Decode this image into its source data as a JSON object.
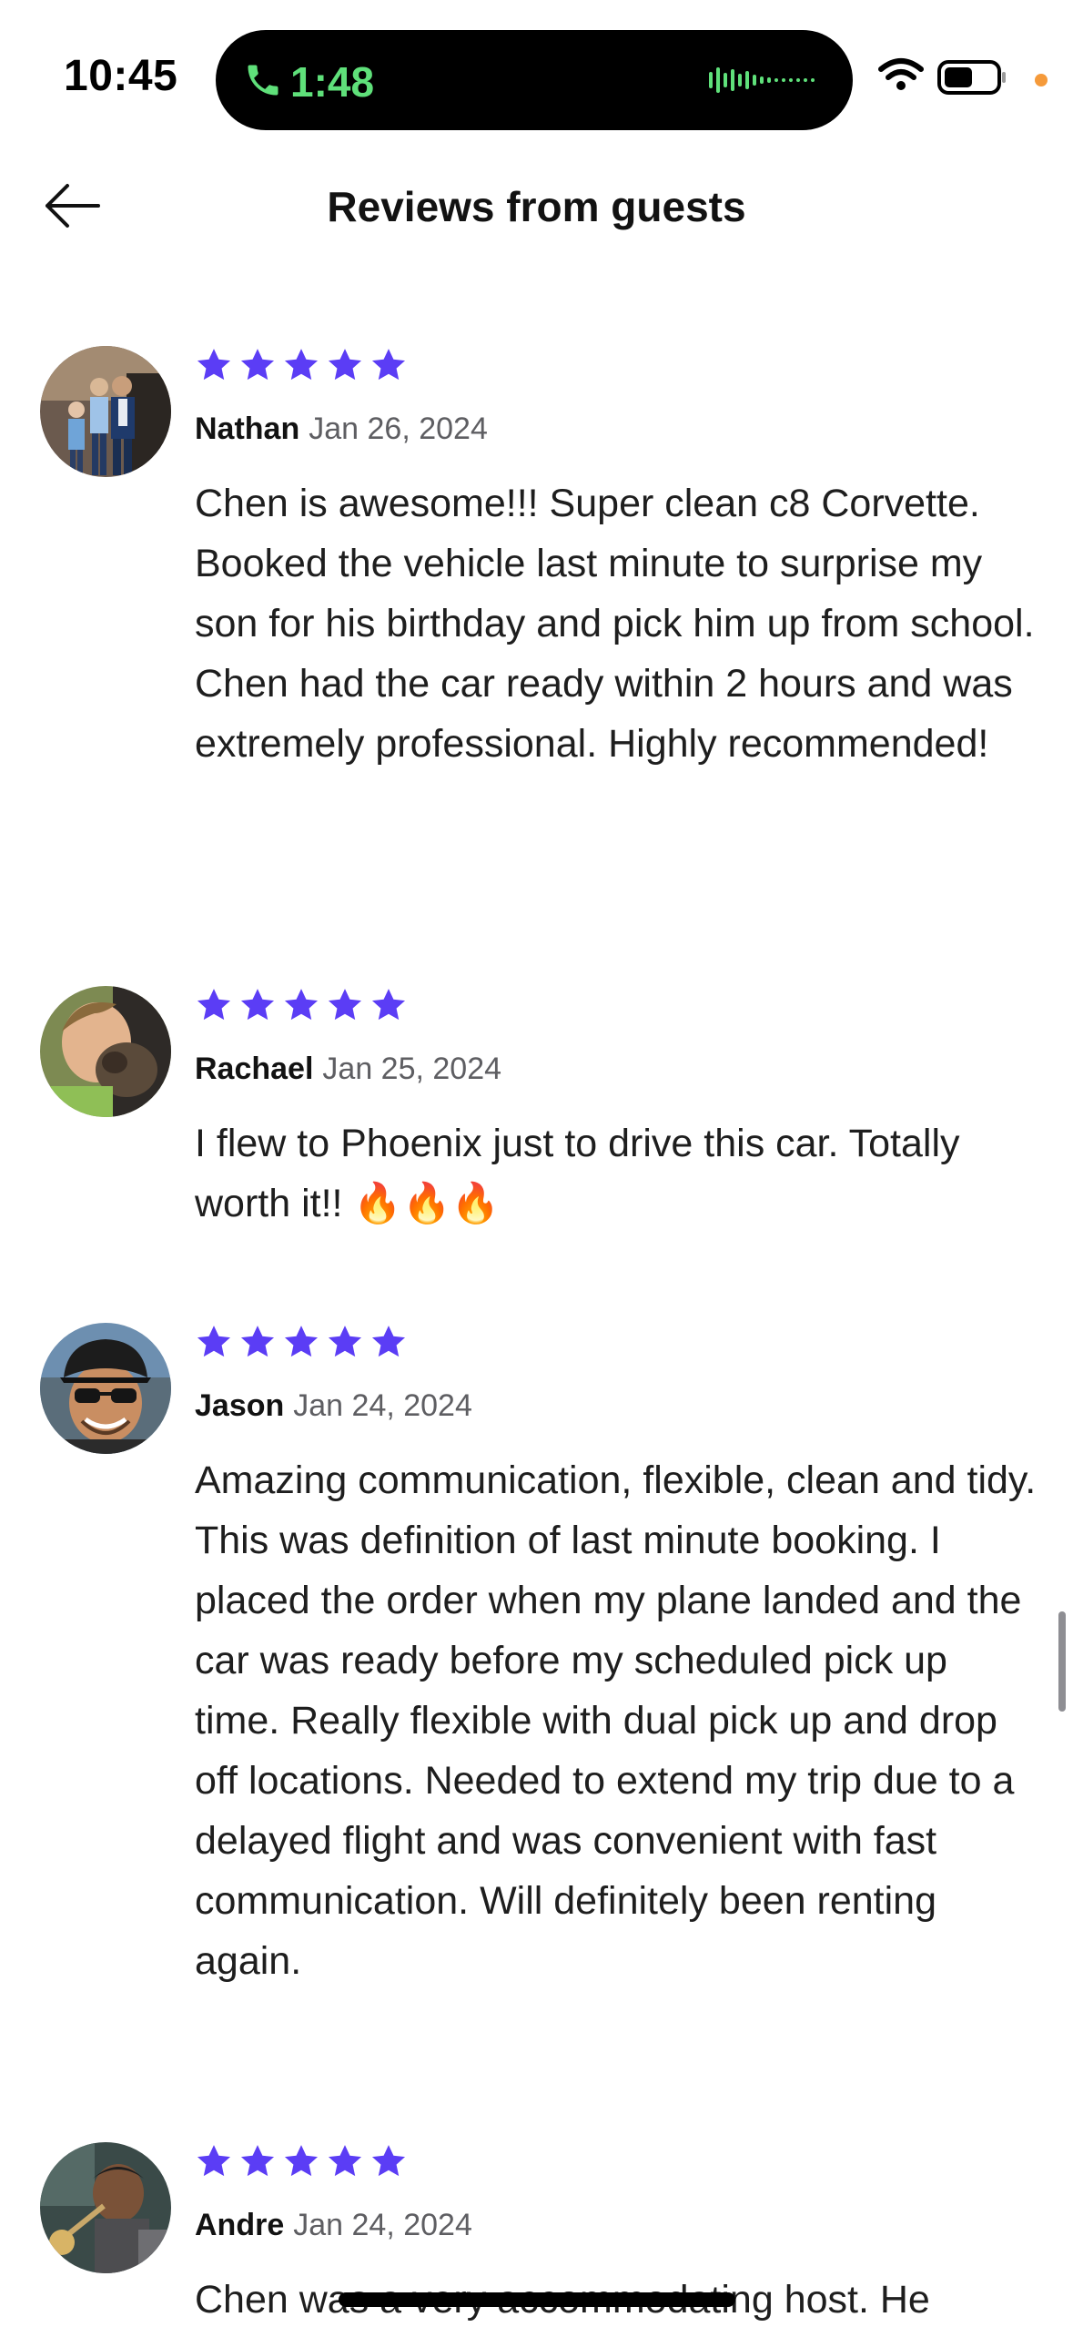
{
  "status_bar": {
    "time": "10:45",
    "call_duration": "1:48",
    "icons": [
      "phone-icon",
      "waveform-icon",
      "wifi-icon",
      "battery-icon",
      "orange-dot-indicator"
    ]
  },
  "header": {
    "back_icon": "arrow-left-icon",
    "title": "Reviews from guests"
  },
  "colors": {
    "star": "#5b3df5",
    "call_green": "#5fe07a",
    "privacy_dot": "#f59a3a",
    "date_gray": "#5e5e62"
  },
  "reviews": [
    {
      "rating": 5,
      "name": "Nathan",
      "date": "Jan 26, 2024",
      "text": "Chen is awesome!!! Super clean c8 Corvette. Booked the vehicle last minute to surprise my son for his birthday and pick him up from school. Chen had the car ready within 2 hours and was extremely professional. Highly recommended!"
    },
    {
      "rating": 5,
      "name": "Rachael",
      "date": "Jan 25, 2024",
      "text": "I flew to Phoenix just to drive this car. Totally worth it!! 🔥🔥🔥"
    },
    {
      "rating": 5,
      "name": "Jason",
      "date": "Jan 24, 2024",
      "text": "Amazing communication, flexible, clean and tidy.  This was definition of last minute booking.  I placed the order when my plane landed and the car was ready before my scheduled pick up time.  Really flexible with dual pick up and drop off locations.  Needed to extend my trip due to a delayed flight and was convenient with fast communication.  Will definitely been renting again."
    },
    {
      "rating": 5,
      "name": "Andre",
      "date": "Jan 24, 2024",
      "text": "Chen was a very accommodating host. He"
    }
  ]
}
